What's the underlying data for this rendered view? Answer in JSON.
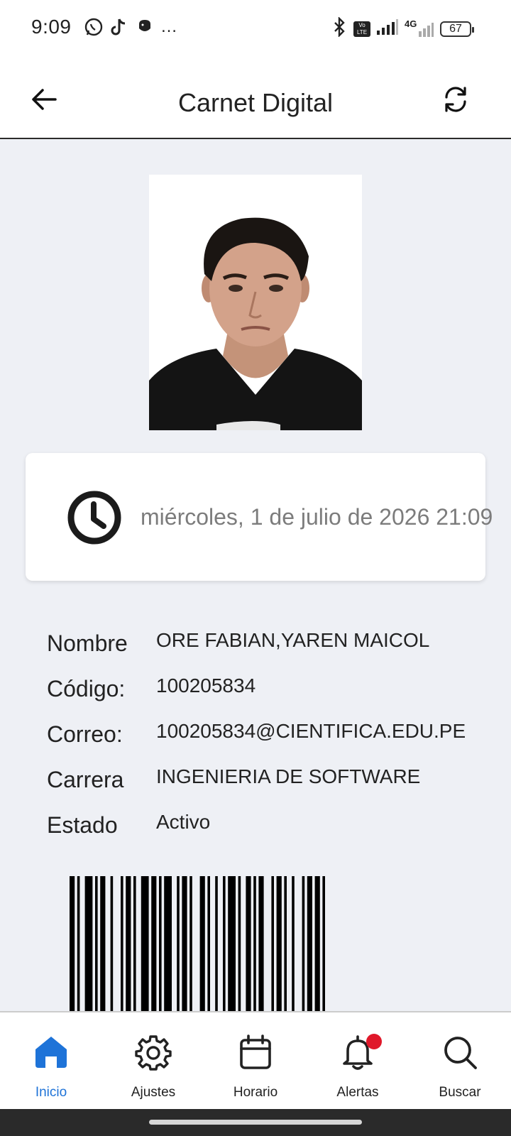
{
  "status_bar": {
    "time": "9:09",
    "dots": "…",
    "volte": "Vo LTE",
    "network": "4G",
    "battery": "67"
  },
  "header": {
    "title": "Carnet Digital"
  },
  "clock_card": {
    "datetime": "miércoles, 1 de julio de 2026 21:09"
  },
  "profile": {
    "rows": [
      {
        "label": "Nombre",
        "value": "ORE FABIAN,YAREN MAICOL"
      },
      {
        "label": "Código:",
        "value": "100205834"
      },
      {
        "label": "Correo:",
        "value": "100205834@CIENTIFICA.EDU.PE"
      },
      {
        "label": "Carrera",
        "value": "INGENIERIA DE SOFTWARE"
      },
      {
        "label": "Estado",
        "value": "Activo"
      }
    ]
  },
  "bottom_nav": {
    "items": [
      {
        "label": "Inicio",
        "icon": "home-icon"
      },
      {
        "label": "Ajustes",
        "icon": "gear-icon"
      },
      {
        "label": "Horario",
        "icon": "calendar-icon"
      },
      {
        "label": "Alertas",
        "icon": "bell-icon"
      },
      {
        "label": "Buscar",
        "icon": "search-icon"
      }
    ],
    "active_index": 0
  },
  "colors": {
    "accent": "#1e73d8",
    "badge": "#e0182a",
    "background": "#eef0f5"
  }
}
